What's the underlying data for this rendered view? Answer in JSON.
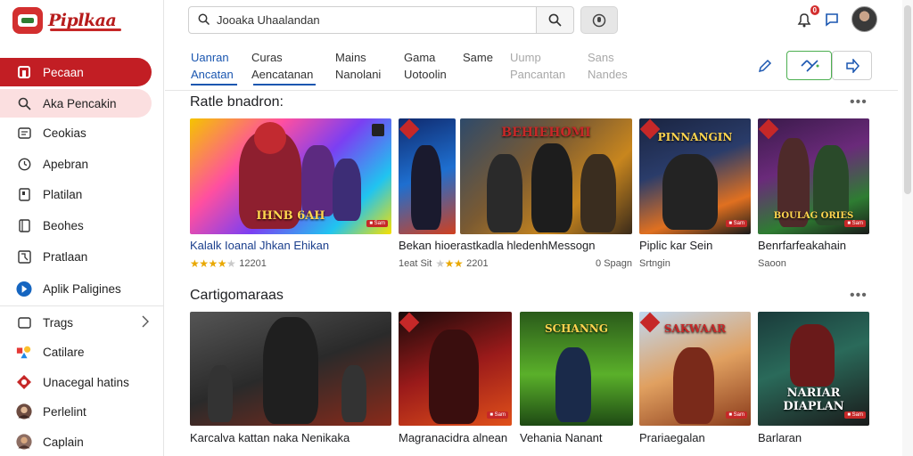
{
  "app": {
    "logo_text": "Piplkaa"
  },
  "search": {
    "value": "Jooaka Uhaalandan"
  },
  "header": {
    "notification_count": "0"
  },
  "sidebar": {
    "items": [
      {
        "label": "Pecaan",
        "icon": "home-icon"
      },
      {
        "label": "Aka Pencakin",
        "icon": "search-icon"
      },
      {
        "label": "Ceokias",
        "icon": "list-icon"
      },
      {
        "label": "Apebran",
        "icon": "clock-icon"
      },
      {
        "label": "Platilan",
        "icon": "doc-icon"
      },
      {
        "label": "Beohes",
        "icon": "bookmark-icon"
      },
      {
        "label": "Pratlaan",
        "icon": "image-icon"
      },
      {
        "label": "Aplik Paligines",
        "icon": "app-circle-icon"
      },
      {
        "label": "Trags",
        "icon": "tag-icon"
      },
      {
        "label": "Catilare",
        "icon": "shapes-icon"
      },
      {
        "label": "Unacegal hatins",
        "icon": "diamond-icon"
      },
      {
        "label": "Perlelint",
        "icon": "user-avatar"
      },
      {
        "label": "Caplain",
        "icon": "user-avatar"
      }
    ]
  },
  "tabs": [
    {
      "line1": "Uanran",
      "line2": "Ancatan"
    },
    {
      "line1": "Curas",
      "line2": "Aencatanan"
    },
    {
      "line1": "Mains",
      "line2": "Nanolani"
    },
    {
      "line1": "Gama",
      "line2": "Uotoolin"
    },
    {
      "line1": "",
      "line2": "Same"
    },
    {
      "line1": "Uump",
      "line2": "Pancantan"
    },
    {
      "line1": "Sans",
      "line2": "Nandes"
    }
  ],
  "sections": [
    {
      "title": "Ratle bnadron:",
      "more": "•••",
      "cards": [
        {
          "title": "Kalalk Ioanal Jhkan Ehikan",
          "stars": 4,
          "rating_text": "12201",
          "extra": "",
          "thumb_caption": "IHNB 6AH",
          "thumb_tag": "■ Sam"
        },
        {
          "title": "Bekan hioerastkadla hledenhMessogn",
          "stars": 2,
          "rating_text": "2201",
          "extra": "0 Spagn",
          "pre": "1eat Sit",
          "thumb_caption": "BEHIEHOMI",
          "thumb_tag": ""
        },
        {
          "title": "Piplic kar Sein",
          "stars": 0,
          "rating_text": "",
          "extra": "",
          "sub": "Srtngin",
          "thumb_caption": "PINNANGIN",
          "thumb_tag": "■ Sam"
        },
        {
          "title": "Benrfarfeakahain",
          "stars": 0,
          "rating_text": "",
          "extra": "",
          "sub": "Saoon",
          "thumb_caption": "BOULAG ORIES",
          "thumb_tag": "■ Sam"
        }
      ]
    },
    {
      "title": "Cartigomaraas",
      "more": "•••",
      "cards": [
        {
          "title": "Karcalva kattan naka Nenikaka",
          "thumb_caption": "",
          "thumb_tag": ""
        },
        {
          "title": "Magranacidra alnean",
          "thumb_caption": "",
          "thumb_tag": "■ Sam"
        },
        {
          "title": "Vehania Nanant",
          "thumb_caption": "SCHANNG",
          "thumb_tag": ""
        },
        {
          "title": "Prariaegalan",
          "thumb_caption": "SAKWAAR",
          "thumb_tag": "■ Sam"
        },
        {
          "title": "Barlaran",
          "thumb_caption": "NARIAR DIAPLAN",
          "thumb_tag": "■ Sam"
        }
      ]
    }
  ],
  "colors": {
    "accent": "#c21e24",
    "link": "#1a56b0",
    "star": "#e9a800"
  }
}
